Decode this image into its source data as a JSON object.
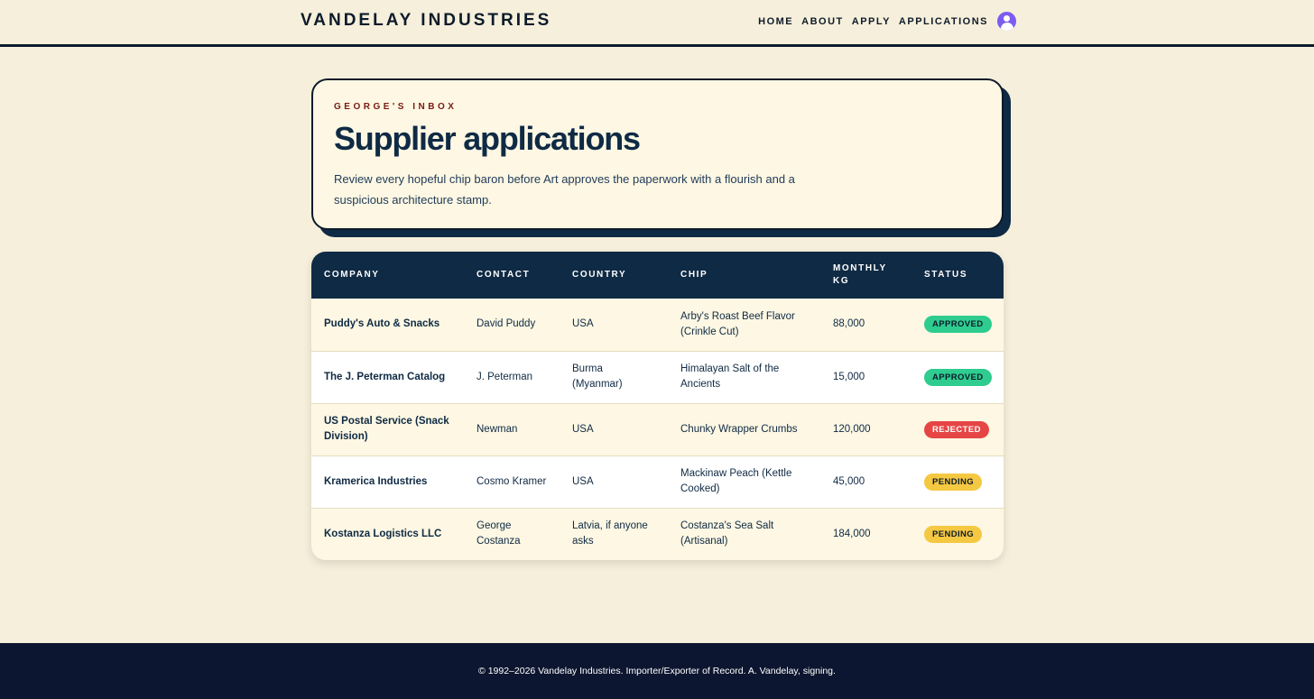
{
  "header": {
    "brand": "VANDELAY INDUSTRIES",
    "nav": [
      {
        "label": "HOME"
      },
      {
        "label": "ABOUT"
      },
      {
        "label": "APPLY"
      },
      {
        "label": "APPLICATIONS"
      }
    ],
    "avatar_icon": "user-avatar-icon",
    "avatar_color": "#7c5cf0"
  },
  "hero": {
    "eyebrow": "GEORGE'S INBOX",
    "title": "Supplier applications",
    "description": "Review every hopeful chip baron before Art approves the paperwork with a flourish and a suspicious architecture stamp."
  },
  "table": {
    "columns": [
      "COMPANY",
      "CONTACT",
      "COUNTRY",
      "CHIP",
      "MONTHLY KG",
      "STATUS"
    ],
    "rows": [
      {
        "company": "Puddy's Auto & Snacks",
        "contact": "David Puddy",
        "country": "USA",
        "chip": "Arby's Roast Beef Flavor (Crinkle Cut)",
        "monthly_kg": "88,000",
        "status": "APPROVED"
      },
      {
        "company": "The J. Peterman Catalog",
        "contact": "J. Peterman",
        "country": "Burma (Myanmar)",
        "chip": "Himalayan Salt of the Ancients",
        "monthly_kg": "15,000",
        "status": "APPROVED"
      },
      {
        "company": "US Postal Service (Snack Division)",
        "contact": "Newman",
        "country": "USA",
        "chip": "Chunky Wrapper Crumbs",
        "monthly_kg": "120,000",
        "status": "REJECTED"
      },
      {
        "company": "Kramerica Industries",
        "contact": "Cosmo Kramer",
        "country": "USA",
        "chip": "Mackinaw Peach (Kettle Cooked)",
        "monthly_kg": "45,000",
        "status": "PENDING"
      },
      {
        "company": "Kostanza Logistics LLC",
        "contact": "George Costanza",
        "country": "Latvia, if anyone asks",
        "chip": "Costanza's Sea Salt (Artisanal)",
        "monthly_kg": "184,000",
        "status": "PENDING"
      }
    ],
    "status_colors": {
      "APPROVED": "#2ecc8f",
      "REJECTED": "#e64545",
      "PENDING": "#f5c842"
    }
  },
  "footer": {
    "text": "© 1992–2026 Vandelay Industries. Importer/Exporter of Record. A. Vandelay, signing."
  }
}
